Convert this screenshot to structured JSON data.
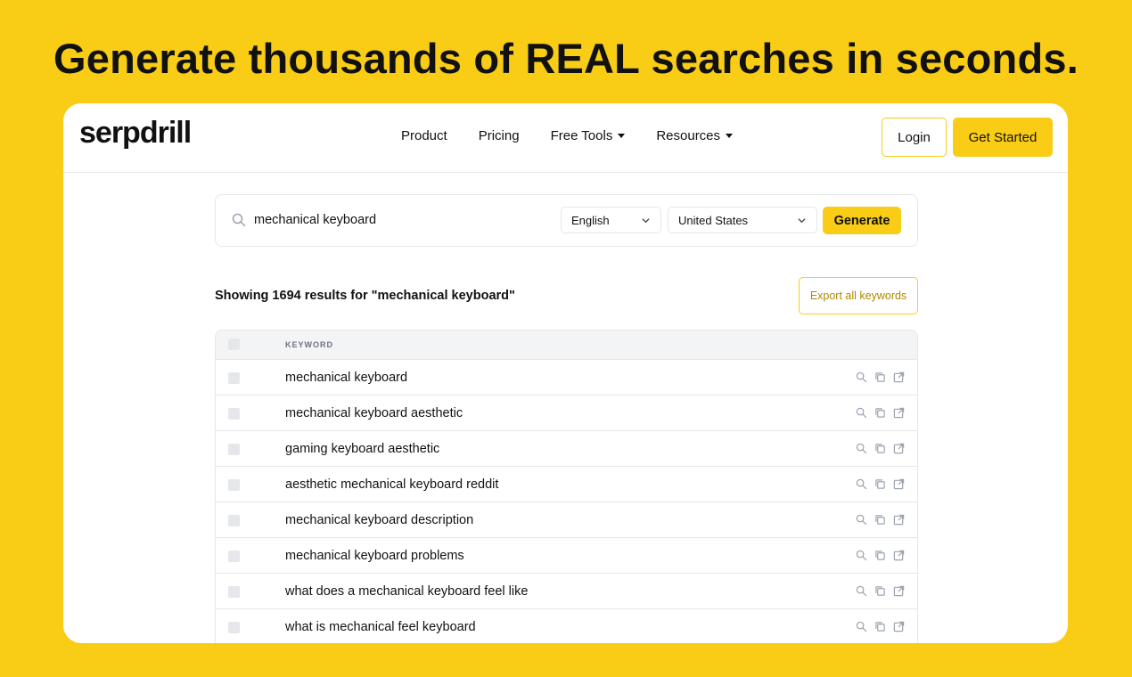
{
  "headline": "Generate thousands of REAL searches in seconds.",
  "nav": {
    "logo": "serpdrill",
    "links": [
      {
        "label": "Product",
        "dropdown": false
      },
      {
        "label": "Pricing",
        "dropdown": false
      },
      {
        "label": "Free Tools",
        "dropdown": true
      },
      {
        "label": "Resources",
        "dropdown": true
      }
    ],
    "login_label": "Login",
    "get_started_label": "Get Started"
  },
  "search": {
    "query": "mechanical keyboard",
    "language": "English",
    "country": "United States",
    "generate_label": "Generate"
  },
  "results": {
    "title": "Showing 1694 results for \"mechanical keyboard\"",
    "export_label": "Export all keywords",
    "column_header": "KEYWORD",
    "rows": [
      "mechanical keyboard",
      "mechanical keyboard aesthetic",
      "gaming keyboard aesthetic",
      "aesthetic mechanical keyboard reddit",
      "mechanical keyboard description",
      "mechanical keyboard problems",
      "what does a mechanical keyboard feel like",
      "what is mechanical feel keyboard"
    ]
  },
  "colors": {
    "brand": "#F9CC16",
    "border": "#E5E7EB",
    "icon_gray": "#9CA3AF"
  },
  "icons": [
    "search-icon",
    "copy-icon",
    "external-link-icon",
    "chevron-down-icon"
  ]
}
